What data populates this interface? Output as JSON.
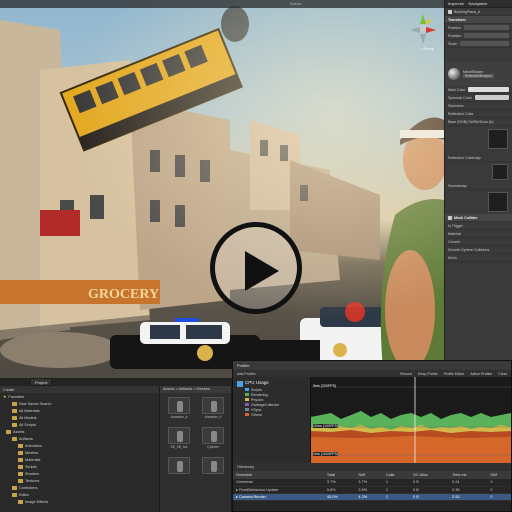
{
  "scene": {
    "tab_title": "Scene",
    "gizmo_label": "< Persp",
    "play_label": "Play video"
  },
  "inspector": {
    "tabs": [
      "Inspector",
      "Navigation"
    ],
    "object_name": "BuildingPlaza_d",
    "rows": [
      {
        "label": "Transform",
        "section": true
      },
      {
        "label": "Position",
        "section": false
      },
      {
        "label": "Rotation",
        "section": false
      },
      {
        "label": "Scale",
        "section": false
      }
    ],
    "shader_label": "MeshShader",
    "shader_value": "Reflective/Bumped",
    "material_rows": [
      "Main Color",
      "Specular Color",
      "Shininess",
      "Reflection Color",
      "Base (RGB) RefStrGloss (A)",
      "",
      "Reflection Cubemap",
      "",
      "Normalmap"
    ],
    "collider_rows": [
      {
        "label": "Mesh Collider",
        "section": true
      },
      {
        "label": "Is Trigger",
        "section": false
      },
      {
        "label": "Material",
        "section": false
      },
      {
        "label": "Convex",
        "section": false
      },
      {
        "label": "Smooth Sphere Collisions",
        "section": false
      },
      {
        "label": "Mesh",
        "section": false
      }
    ]
  },
  "project": {
    "tab_label": "Project",
    "create_label": "Create",
    "favorites_label": "Favorites",
    "tree": [
      {
        "label": "New Saved Search",
        "level": 1
      },
      {
        "label": "All Materials",
        "level": 1
      },
      {
        "label": "All Models",
        "level": 1
      },
      {
        "label": "All Scripts",
        "level": 1
      },
      {
        "label": "Assets",
        "level": 0
      },
      {
        "label": "Artifacts",
        "level": 1
      },
      {
        "label": "Animation",
        "level": 2
      },
      {
        "label": "Meshes",
        "level": 2
      },
      {
        "label": "Materials",
        "level": 2
      },
      {
        "label": "Scripts",
        "level": 2
      },
      {
        "label": "Shaders",
        "level": 2
      },
      {
        "label": "Textures",
        "level": 2
      },
      {
        "label": "Controllers",
        "level": 1
      },
      {
        "label": "Editor",
        "level": 1
      },
      {
        "label": "Image Effects",
        "level": 2
      }
    ]
  },
  "assets": {
    "breadcrumb": "Assets > Artifacts > Meshes",
    "items": [
      "character_a",
      "character_b",
      "SE_Kill_Act",
      "Cylinder",
      "",
      ""
    ]
  },
  "profiler": {
    "title": "Profiler",
    "tab_label": "Add Profiler",
    "toolbar": [
      "Record",
      "Deep Profile",
      "Profile Editor",
      "Active Profiler"
    ],
    "clear_label": "Clear",
    "cpu_title": "CPU Usage",
    "legend": [
      {
        "label": "Scripts",
        "color": "#4fa1e6"
      },
      {
        "label": "Rendering",
        "color": "#5ab35a"
      },
      {
        "label": "Physics",
        "color": "#d3b94a"
      },
      {
        "label": "GarbageCollector",
        "color": "#8b56c4"
      },
      {
        "label": "VSync",
        "color": "#6a8a9a"
      },
      {
        "label": "Others",
        "color": "#d5672a"
      }
    ],
    "graph_labels": [
      "5ms (200FPS)",
      "10ms (100FPS)",
      "1ms (1000FPS)"
    ],
    "hierarchy_label": "Hierarchy",
    "columns": [
      "Overview",
      "Total",
      "Self",
      "Calls",
      "GC Alloc",
      "Time ms",
      "Self"
    ],
    "rows": [
      [
        "Overhead",
        "3.7%",
        "3.7%",
        "1",
        "0 B",
        "0.24",
        "0"
      ],
      [
        "▸ FixedBehaviour.Update",
        "5.8%",
        "2.6%",
        "1",
        "0 B",
        "0.38",
        "0"
      ],
      [
        "▸ Camera.Render",
        "45.0%",
        "4.2%",
        "1",
        "0 B",
        "2.93",
        "0"
      ]
    ]
  }
}
